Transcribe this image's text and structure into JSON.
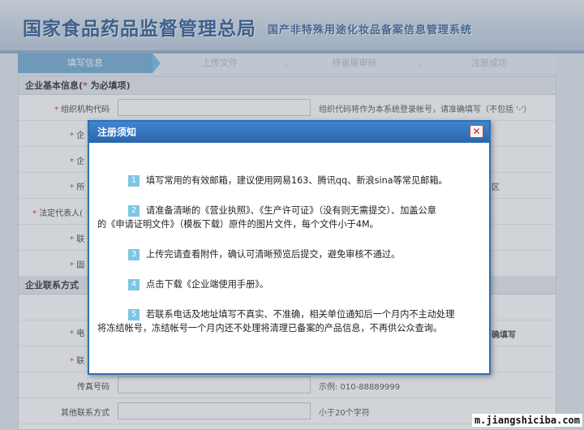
{
  "header": {
    "title": "国家食品药品监督管理总局",
    "subtitle": "国产非特殊用途化妆品备案信息管理系统"
  },
  "steps": [
    {
      "label": "填写信息",
      "active": true
    },
    {
      "label": "上传文件",
      "active": false
    },
    {
      "label": "待省局审核",
      "active": false
    },
    {
      "label": "注册成功",
      "active": false
    }
  ],
  "form": {
    "section_basic": {
      "title": "企业基本信息(",
      "star": "*",
      "note": " 为必填项)"
    },
    "org_code": {
      "star": "*",
      "label": "组织机构代码",
      "hint": "组织代码将作为本系统登录帐号，请准确填写（不包括 '-'）"
    },
    "fragments": {
      "f1": "企",
      "f2": "企",
      "f3": "所",
      "f4": "法定代表人(",
      "f5": "联",
      "f6": "固",
      "f7": "区",
      "f8": "电",
      "f9": "联",
      "f10": "确填写",
      "star": "*"
    },
    "section_contact": {
      "title": "企业联系方式"
    },
    "fax": {
      "label": "传真号码",
      "hint": "示例: 010-88889999"
    },
    "other_contact": {
      "label": "其他联系方式",
      "hint": "小于20个字符"
    }
  },
  "modal": {
    "title": "注册须知",
    "close_glyph": "✕",
    "items": [
      {
        "num": "1",
        "text": "填写常用的有效邮箱，建议使用网易163、腾讯qq、新浪sina等常见邮箱。"
      },
      {
        "num": "2",
        "text_a": "请准备清晰的《营业执照》、《生产许可证》（没有则无需提交）、加盖公章",
        "text_b": "的《申请证明文件》（",
        "link": "模板下载",
        "text_c": "）原件的图片文件，每个文件小于4M。"
      },
      {
        "num": "3",
        "text": "上传完请查看附件，确认可清晰预览后提交，避免审核不通过。"
      },
      {
        "num": "4",
        "text_a": "点击下载",
        "link": "《企业端使用手册》",
        "text_b": "。"
      },
      {
        "num": "5",
        "text_a": "若联系电话及地址填写不真实、不准确，相关单位通知后一个月内不主动处理",
        "text_b": "将冻结帐号，冻结帐号一个月内还不处理将清理已备案的产品信息，不再供公众查询。"
      }
    ]
  },
  "watermark": "m.jiangshiciba.com"
}
